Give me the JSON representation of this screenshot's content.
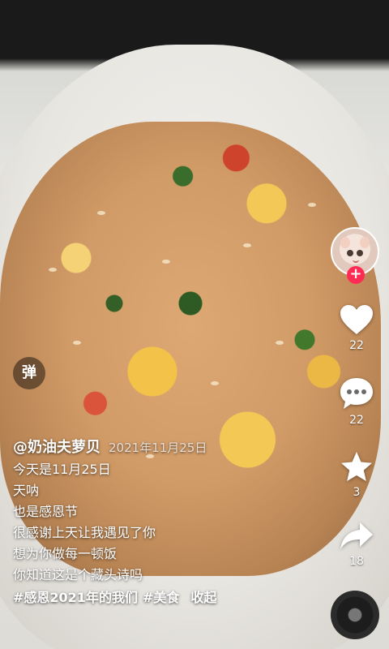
{
  "video": {
    "background": "fried rice on white plate",
    "danmu_label": "弹"
  },
  "actions": {
    "like_count": "22",
    "comment_count": "22",
    "favorite_count": "3",
    "share_count": "18",
    "follow_symbol": "+"
  },
  "caption": {
    "author": "@奶油夫萝贝",
    "date": "2021年11月25日",
    "lines": [
      "今天是11月25日",
      "天呐",
      "也是感恩节",
      "很感谢上天让我遇见了你",
      "想为你做每一顿饭",
      "你知道这是个藏头诗吗"
    ],
    "tags": [
      "#感恩2021年的我们",
      "#美食"
    ],
    "collapse_label": "收起"
  },
  "colors": {
    "accent": "#fe2c55",
    "text": "#ffffff"
  }
}
